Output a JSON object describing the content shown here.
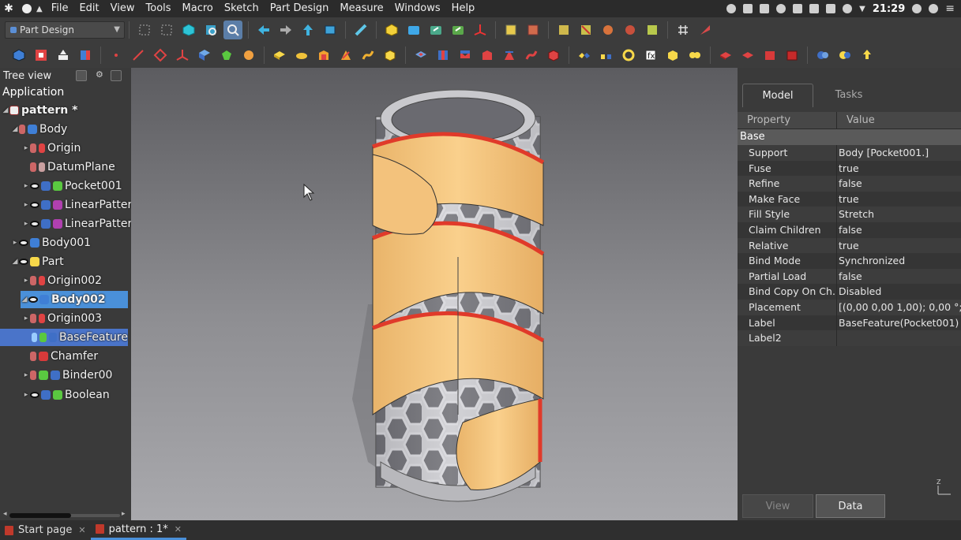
{
  "menubar": {
    "items": [
      "File",
      "Edit",
      "View",
      "Tools",
      "Macro",
      "Sketch",
      "Part Design",
      "Measure",
      "Windows",
      "Help"
    ],
    "clock": "21:29"
  },
  "toolbar": {
    "workbench": "Part Design"
  },
  "tree": {
    "title": "Tree view",
    "application": "Application",
    "nodes": [
      {
        "label": "pattern *"
      },
      {
        "label": "Body"
      },
      {
        "label": "Origin"
      },
      {
        "label": "DatumPlane"
      },
      {
        "label": "Pocket001"
      },
      {
        "label": "LinearPatter"
      },
      {
        "label": "LinearPatter"
      },
      {
        "label": "Body001"
      },
      {
        "label": "Part"
      },
      {
        "label": "Origin002"
      },
      {
        "label": "Body002"
      },
      {
        "label": "Origin003"
      },
      {
        "label": "BaseFeature"
      },
      {
        "label": "Chamfer"
      },
      {
        "label": "Binder00"
      },
      {
        "label": "Boolean"
      }
    ]
  },
  "properties": {
    "tabs": [
      "Model",
      "Tasks"
    ],
    "columns": [
      "Property",
      "Value"
    ],
    "group": "Base",
    "rows": [
      {
        "key": "Support",
        "value": "Body [Pocket001.]"
      },
      {
        "key": "Fuse",
        "value": "true"
      },
      {
        "key": "Refine",
        "value": "false"
      },
      {
        "key": "Make Face",
        "value": "true"
      },
      {
        "key": "Fill Style",
        "value": "Stretch"
      },
      {
        "key": "Claim Children",
        "value": "false"
      },
      {
        "key": "Relative",
        "value": "true"
      },
      {
        "key": "Bind Mode",
        "value": "Synchronized"
      },
      {
        "key": "Partial Load",
        "value": "false"
      },
      {
        "key": "Bind Copy On Ch...",
        "value": "Disabled"
      },
      {
        "key": "Placement",
        "value": "[(0,00 0,00 1,00); 0,00 °; (..."
      },
      {
        "key": "Label",
        "value": "BaseFeature(Pocket001)"
      },
      {
        "key": "Label2",
        "value": ""
      }
    ],
    "bottom_tabs": [
      "View",
      "Data"
    ],
    "axis_label": "Z"
  },
  "doc_tabs": [
    {
      "label": "Start page"
    },
    {
      "label": "pattern : 1*"
    }
  ],
  "colors": {
    "selection": "#4a90d9",
    "band": "#f5c27a",
    "band_edge": "#e03a2a",
    "body_grey": "#b8b8bc"
  }
}
